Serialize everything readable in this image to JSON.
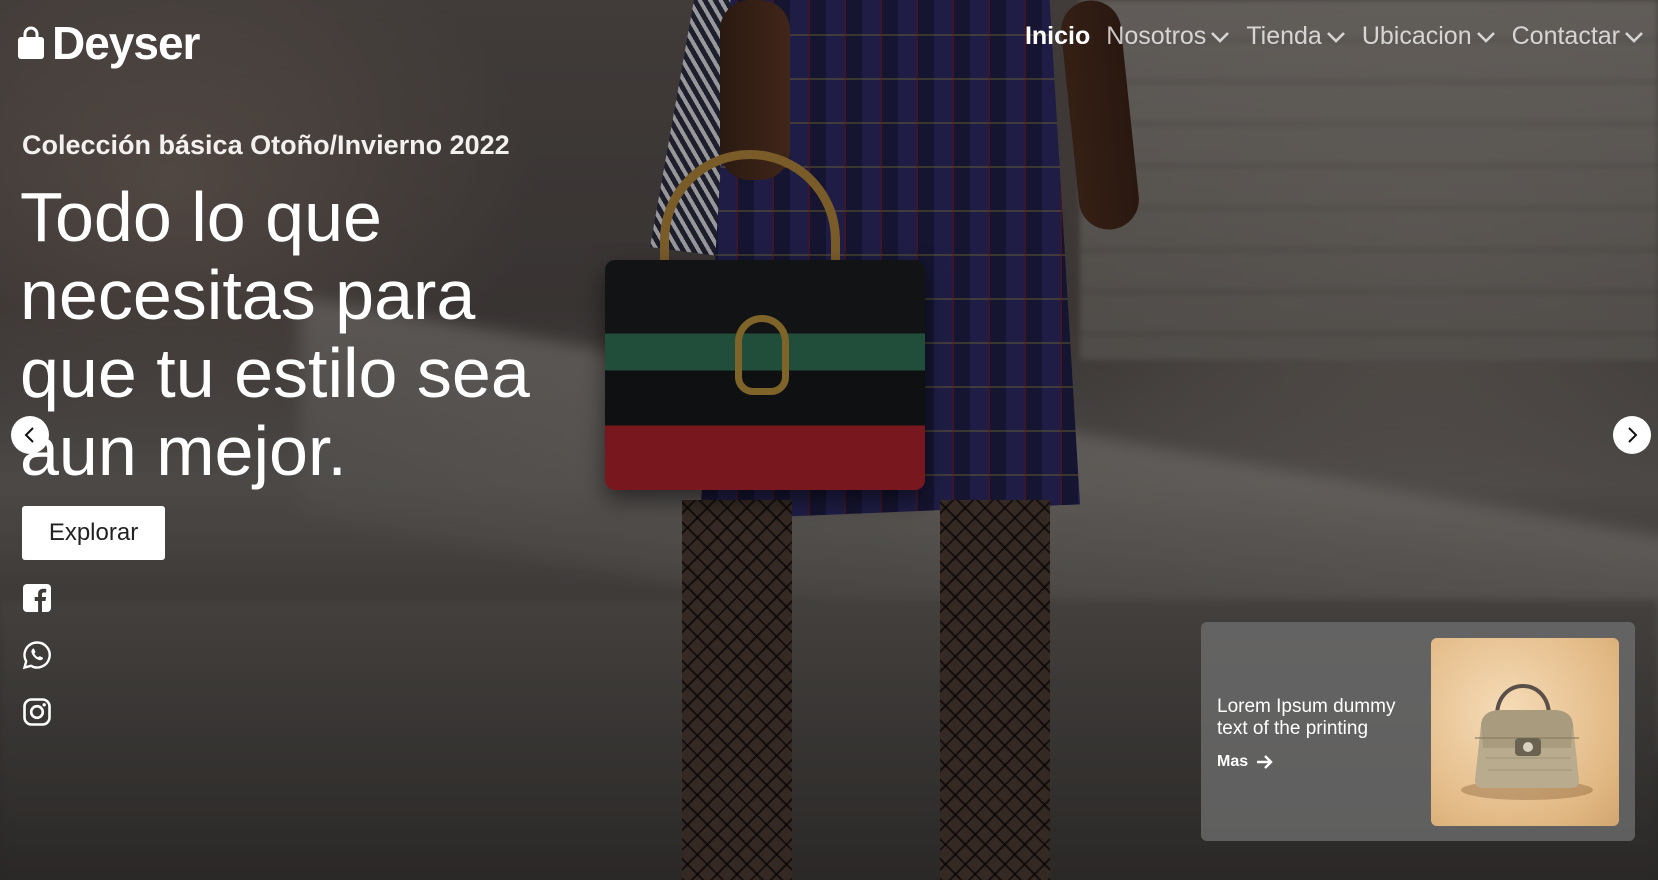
{
  "brand": {
    "name": "Deyser",
    "logo_icon": "shopping-bag-icon"
  },
  "nav": {
    "items": [
      {
        "label": "Inicio",
        "active": true,
        "dropdown": false
      },
      {
        "label": "Nosotros",
        "active": false,
        "dropdown": true
      },
      {
        "label": "Tienda",
        "active": false,
        "dropdown": true
      },
      {
        "label": "Ubicacion",
        "active": false,
        "dropdown": true
      },
      {
        "label": "Contactar",
        "active": false,
        "dropdown": true
      }
    ]
  },
  "hero": {
    "eyebrow": "Colección básica Otoño/Invierno 2022",
    "headline": "Todo lo que necesitas para que tu estilo sea aun mejor.",
    "cta_label": "Explorar"
  },
  "social": [
    {
      "icon": "facebook-icon"
    },
    {
      "icon": "whatsapp-icon"
    },
    {
      "icon": "instagram-icon"
    }
  ],
  "carousel": {
    "prev_icon": "chevron-left-icon",
    "next_icon": "chevron-right-icon"
  },
  "promo": {
    "text": "Lorem Ipsum dummy text of the printing",
    "link_label": "Mas",
    "link_icon": "arrow-right-icon",
    "image": "handbag-product-image"
  },
  "colors": {
    "text": "#ffffff",
    "button_bg": "#ffffff",
    "button_text": "#222222",
    "card_bg": "#6e6e6e"
  }
}
